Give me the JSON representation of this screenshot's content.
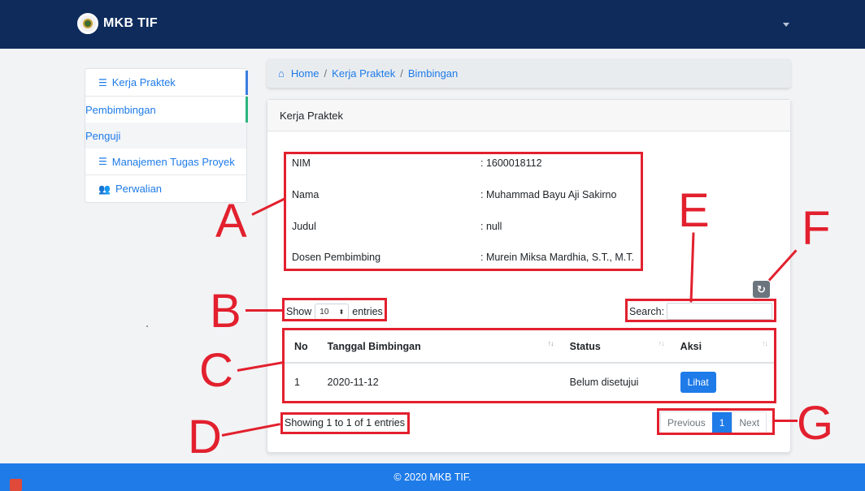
{
  "navbar": {
    "brand": "MKB TIF"
  },
  "sidebar": {
    "items": [
      {
        "label": "Kerja Praktek",
        "icon": "list-icon"
      },
      {
        "label": "Pembimbingan"
      },
      {
        "label": "Penguji"
      },
      {
        "label": "Manajemen Tugas Proyek",
        "icon": "list-icon"
      },
      {
        "label": "Perwalian",
        "icon": "users-icon"
      }
    ]
  },
  "breadcrumb": {
    "items": [
      "Home",
      "Kerja Praktek",
      "Bimbingan"
    ],
    "separator": "/"
  },
  "card": {
    "title": "Kerja Praktek",
    "info": [
      {
        "label": "NIM",
        "value": ": 1600018112"
      },
      {
        "label": "Nama",
        "value": ": Muhammad Bayu Aji Sakirno"
      },
      {
        "label": "Judul",
        "value": ": null"
      },
      {
        "label": "Dosen Pembimbing",
        "value": ": Murein Miksa Mardhia, S.T., M.T."
      }
    ]
  },
  "table_controls": {
    "show_label": "Show",
    "entries_value": "10",
    "entries_label": "entries",
    "search_label": "Search:",
    "search_value": ""
  },
  "table": {
    "headers": [
      "No",
      "Tanggal Bimbingan",
      "Status",
      "Aksi"
    ],
    "rows": [
      {
        "no": "1",
        "tanggal": "2020-11-12",
        "status": "Belum disetujui",
        "aksi": "Lihat"
      }
    ]
  },
  "info_text": "Showing 1 to 1 of 1 entries",
  "pagination": {
    "previous": "Previous",
    "current": "1",
    "next": "Next"
  },
  "footer": {
    "text": "© 2020 MKB TIF."
  },
  "annotations": [
    "A",
    "B",
    "C",
    "D",
    "E",
    "F",
    "G"
  ],
  "colors": {
    "navbar": "#0e2b5c",
    "accent": "#1e7be8",
    "annotation": "#e2202e",
    "footer": "#1e7be8"
  }
}
